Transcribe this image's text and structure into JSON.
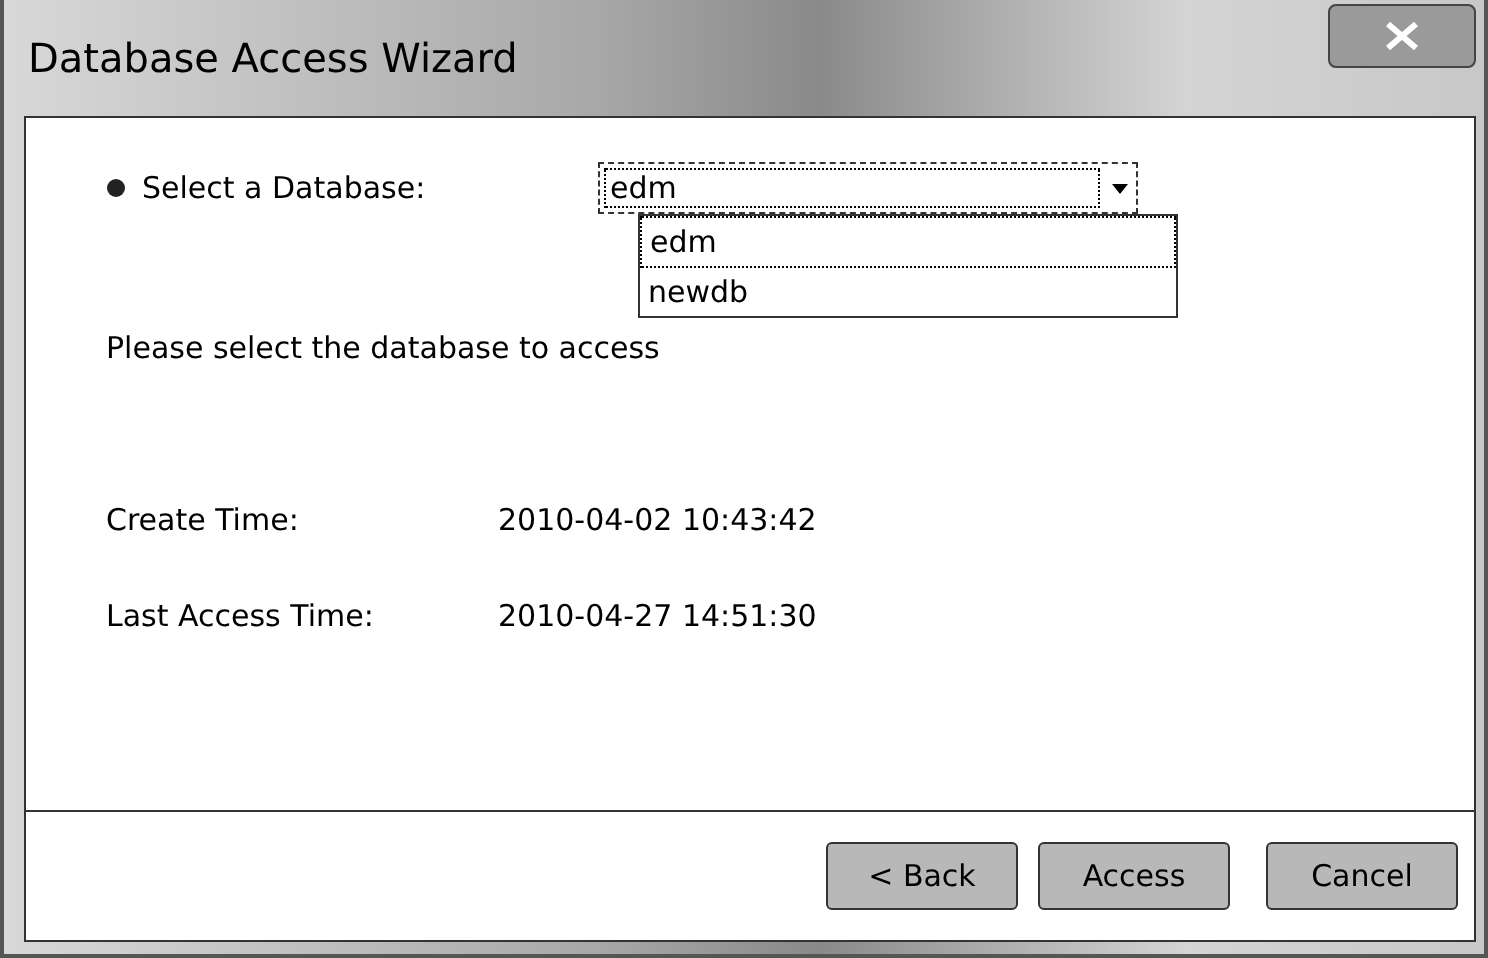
{
  "window": {
    "title": "Database Access Wizard"
  },
  "database": {
    "label": "Select a Database:",
    "value": "edm",
    "expanded": true,
    "options": [
      {
        "label": "edm",
        "selected": true
      },
      {
        "label": "newdb",
        "selected": false
      }
    ]
  },
  "message": "Please select the database to access",
  "fields": [
    {
      "label": "Create Time:",
      "value": "2010-04-02 10:43:42"
    },
    {
      "label": "Last Access Time:",
      "value": "2010-04-27 14:51:30"
    }
  ],
  "buttons": [
    "< Back",
    "Access",
    "Cancel"
  ]
}
